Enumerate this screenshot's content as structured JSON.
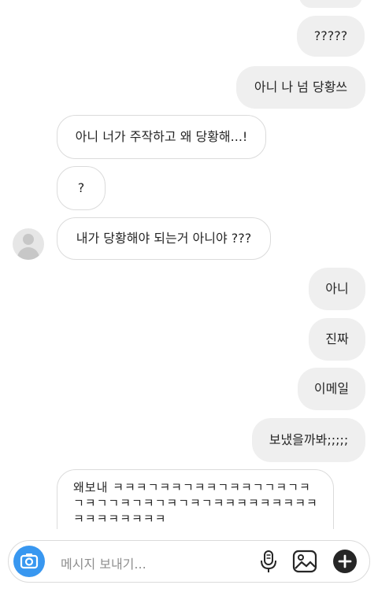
{
  "messages": [
    {
      "side": "out",
      "text": "?????"
    },
    {
      "side": "out",
      "text": "아니 나 넘 당황쓰"
    },
    {
      "side": "in",
      "text": "아니 너가 주작하고 왜 당황해...!"
    },
    {
      "side": "in",
      "text": "?"
    },
    {
      "side": "in",
      "text": "내가 당황해야 되는거 아니야 ???"
    },
    {
      "side": "out",
      "text": "아니"
    },
    {
      "side": "out",
      "text": "진짜"
    },
    {
      "side": "out",
      "text": "이메일"
    },
    {
      "side": "out",
      "text": "보냈을까봐;;;;;"
    }
  ],
  "long_message": {
    "line1": "왜보내 ㅋㅋㅋㄱㅋㅋㄱㅋㅋㄱㅋㅋㄱㄱㅋㄱㅋ",
    "line2": "ㄱㅋㄱㄱㅋㄱㅋㄱㅋㄱㅋㄱㅋㅋㅋㅋㅋㅋㅋㅋㅋ",
    "line3": "ㅋㅋㅋㅋㅋㅋㅋㅋ"
  },
  "composer": {
    "placeholder": "메시지 보내기..."
  },
  "colors": {
    "accent": "#3897f0",
    "outgoing_bubble": "#efefef",
    "border": "#dbdbdb"
  },
  "icons": [
    "camera-icon",
    "microphone-icon",
    "gallery-icon",
    "plus-icon",
    "avatar-icon"
  ]
}
